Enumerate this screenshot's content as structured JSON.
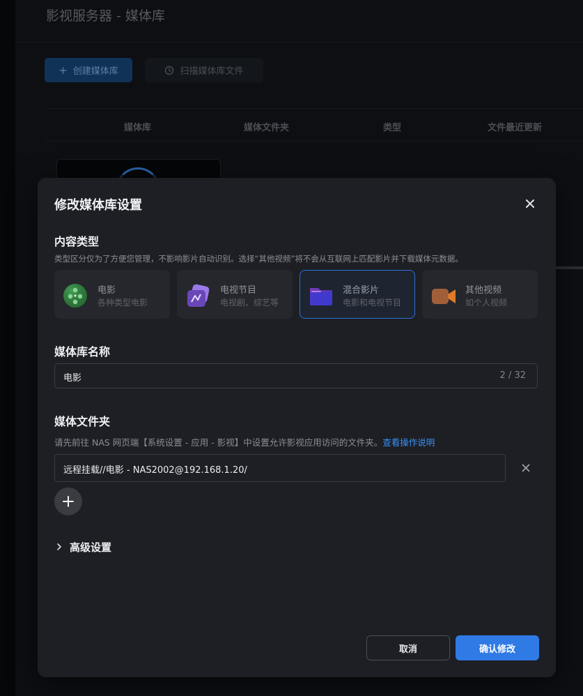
{
  "background": {
    "page_title": "影视服务器 - 媒体库",
    "create_button": {
      "icon": "plus-icon",
      "label": "创建媒体库"
    },
    "scan_button": {
      "icon": "scan-clock-icon",
      "label": "扫描媒体库文件"
    },
    "table_headers": [
      "媒体库",
      "媒体文件夹",
      "类型",
      "文件最近更新"
    ]
  },
  "modal": {
    "title": "修改媒体库设置",
    "close_icon": "close-icon",
    "content_type": {
      "title": "内容类型",
      "description": "类型区分仅为了方便您管理，不影响影片自动识别。选择“其他视频”将不会从互联网上匹配影片并下载媒体元数据。",
      "options": [
        {
          "name": "电影",
          "sub": "各种类型电影",
          "icon": "film-reel-icon",
          "color": "#3a8a4a",
          "selected": false
        },
        {
          "name": "电视节目",
          "sub": "电视剧、综艺等",
          "icon": "tv-icon",
          "color": "#7a55c8",
          "selected": false
        },
        {
          "name": "混合影片",
          "sub": "电影和电视节目",
          "icon": "folder-icon",
          "color": "#4a3ab0",
          "selected": true
        },
        {
          "name": "其他视频",
          "sub": "如个人视频",
          "icon": "video-camera-icon",
          "color": "#d0702a",
          "selected": false
        }
      ]
    },
    "library_name": {
      "title": "媒体库名称",
      "value": "电影",
      "count": "2 / 32"
    },
    "media_folder": {
      "title": "媒体文件夹",
      "description": "请先前往 NAS 网页端【系统设置 - 应用 - 影视】中设置允许影视应用访问的文件夹。",
      "link": "查看操作说明",
      "folders": [
        "远程挂载//电影 - NAS2002@192.168.1.20/"
      ],
      "add_icon": "plus-icon"
    },
    "advanced": {
      "label": "高级设置",
      "icon": "chevron-right-icon"
    },
    "cancel_label": "取消",
    "confirm_label": "确认修改"
  },
  "colors": {
    "accent": "#2f7ae5",
    "modal_bg": "#1d1f24",
    "selected_border": "#2f6fd6"
  }
}
